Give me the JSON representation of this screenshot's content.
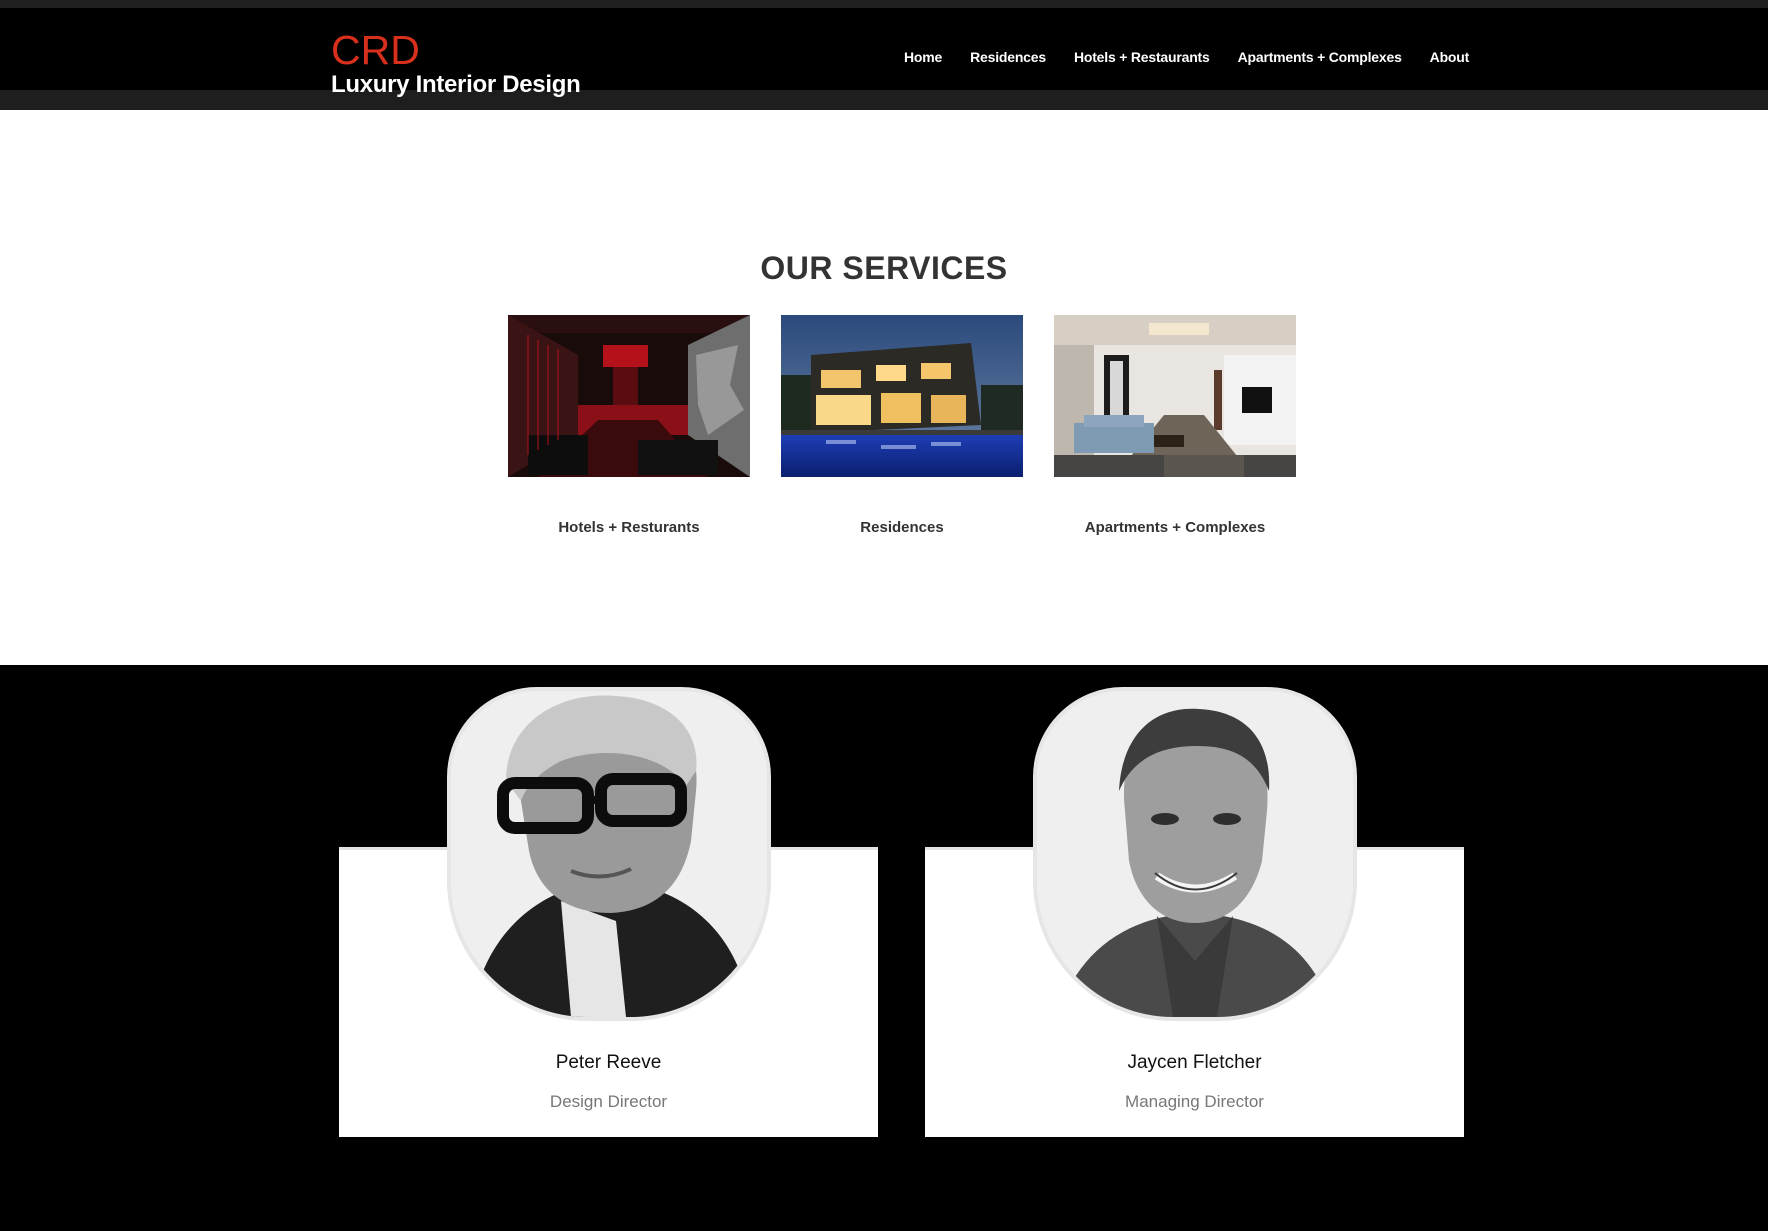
{
  "header": {
    "logo_mark": "CRD",
    "logo_sub": "Luxury Interior Design",
    "nav": [
      "Home",
      "Residences",
      "Hotels + Restaurants",
      "Apartments + Complexes",
      "About"
    ]
  },
  "services": {
    "title": "OUR SERVICES",
    "items": [
      {
        "label": "Hotels + Resturants",
        "image": "restaurant interior (red)"
      },
      {
        "label": "Residences",
        "image": "house with pool at dusk"
      },
      {
        "label": "Apartments + Complexes",
        "image": "apartment living room"
      }
    ]
  },
  "team": [
    {
      "name": "Peter Reeve",
      "role": "Design Director"
    },
    {
      "name": "Jaycen Fletcher",
      "role": "Managing Director"
    }
  ],
  "colors": {
    "accent": "#d9301d",
    "header_bg": "#000000",
    "page_bg": "#ffffff",
    "team_bg": "#000000"
  }
}
